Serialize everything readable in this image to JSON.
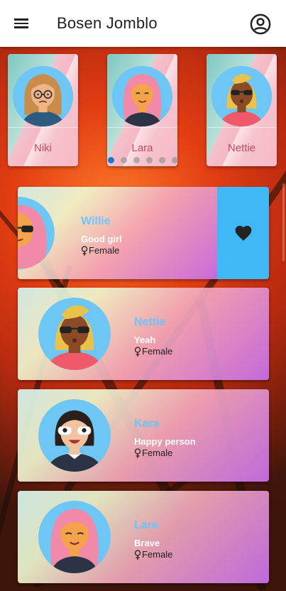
{
  "appbar": {
    "title": "Bosen Jomblo",
    "menu_icon": "hamburger-menu-icon",
    "account_icon": "account-circle-icon"
  },
  "carousel": {
    "items": [
      {
        "name": "Niki"
      },
      {
        "name": "Lara"
      },
      {
        "name": "Nettie"
      }
    ],
    "active_dot": 0,
    "dot_count": 6
  },
  "swiped_card": {
    "name": "Willie",
    "description": "Good girl",
    "gender": "Female",
    "like_icon": "heart-icon"
  },
  "cards": [
    {
      "name": "Nettie",
      "description": "Yeah",
      "gender": "Female"
    },
    {
      "name": "Kara",
      "description": "Happy person",
      "gender": "Female"
    },
    {
      "name": "Lara",
      "description": "Brave",
      "gender": "Female"
    }
  ],
  "colors": {
    "accent": "#1976d2",
    "like_button": "#3fb8f5",
    "name_text": "#6ec6ff"
  }
}
